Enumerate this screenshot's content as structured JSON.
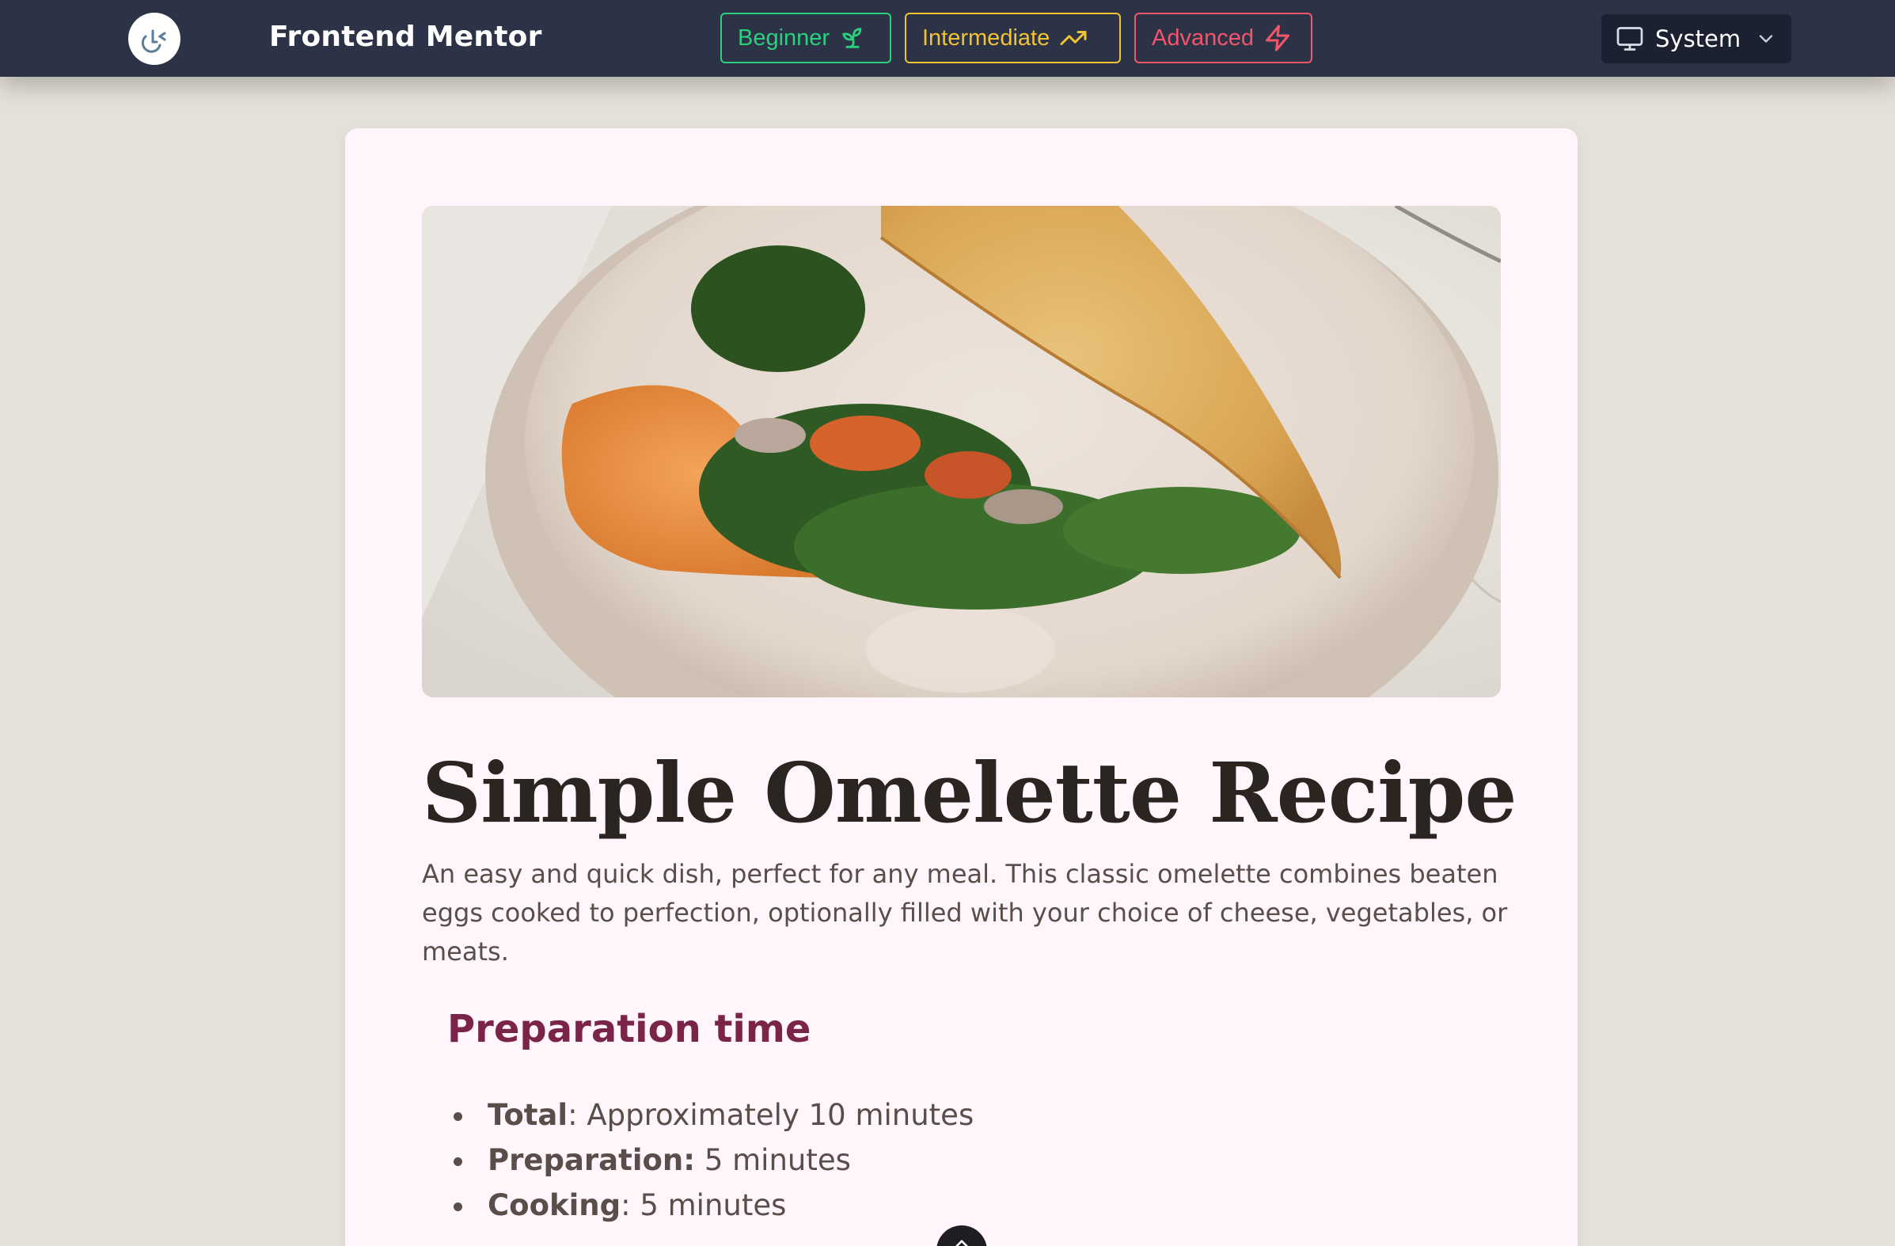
{
  "navbar": {
    "brand": "Frontend Mentor",
    "levels": {
      "beginner": "Beginner",
      "intermediate": "Intermediate",
      "advanced": "Advanced"
    },
    "theme": "System"
  },
  "colors": {
    "nav_bg": "#2c3347",
    "beginner": "#2bcf7e",
    "intermediate": "#f1c232",
    "advanced": "#f3556a",
    "heading_accent": "#7a2449",
    "card_bg": "#fff5fb",
    "page_bg": "#e4e0da"
  },
  "recipe": {
    "title": "Simple Omelette Recipe",
    "intro": "An easy and quick dish, perfect for any meal. This classic omelette combines beaten eggs cooked to perfection, optionally filled with your choice of cheese, vegetables, or meats.",
    "preparation": {
      "heading": "Preparation time",
      "items": [
        {
          "label": "Total",
          "value": ": Approximately 10 minutes"
        },
        {
          "label": "Preparation:",
          "value": " 5 minutes"
        },
        {
          "label": "Cooking",
          "value": ": 5 minutes"
        }
      ]
    }
  },
  "icons": {
    "logo": "logo-icon",
    "beginner": "sprout-icon",
    "intermediate": "trending-up-icon",
    "advanced": "lightning-icon",
    "theme": "monitor-icon",
    "dropdown": "chevron-down-icon",
    "fab": "chevron-up-icon"
  }
}
